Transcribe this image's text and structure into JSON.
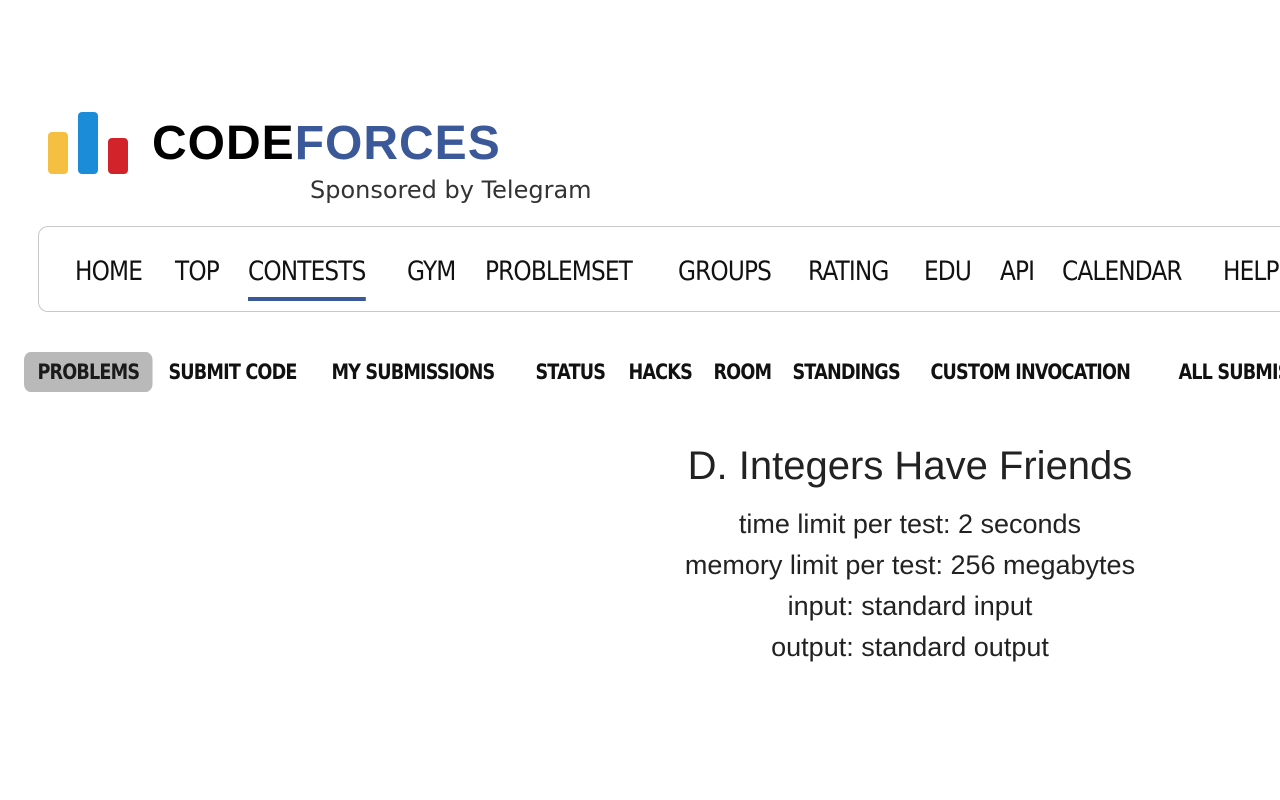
{
  "brand": {
    "name_part1": "CODE",
    "name_part2": "FORCES",
    "tagline": "Sponsored by Telegram",
    "colors": {
      "yellow": "#f5bf42",
      "blue": "#1a8cd8",
      "red": "#d2232a",
      "forces_text": "#3b5998"
    }
  },
  "main_nav": {
    "items": [
      {
        "label": "HOME"
      },
      {
        "label": "TOP"
      },
      {
        "label": "CONTESTS"
      },
      {
        "label": "GYM"
      },
      {
        "label": "PROBLEMSET"
      },
      {
        "label": "GROUPS"
      },
      {
        "label": "RATING"
      },
      {
        "label": "EDU"
      },
      {
        "label": "API"
      },
      {
        "label": "CALENDAR"
      },
      {
        "label": "HELP"
      }
    ],
    "active": "CONTESTS"
  },
  "sub_nav": {
    "items": [
      {
        "label": "PROBLEMS"
      },
      {
        "label": "SUBMIT CODE"
      },
      {
        "label": "MY SUBMISSIONS"
      },
      {
        "label": "STATUS"
      },
      {
        "label": "HACKS"
      },
      {
        "label": "ROOM"
      },
      {
        "label": "STANDINGS"
      },
      {
        "label": "CUSTOM INVOCATION"
      },
      {
        "label": "ALL SUBMISSIONS"
      }
    ],
    "selected": "PROBLEMS"
  },
  "problem": {
    "title": "D. Integers Have Friends",
    "time_limit": "time limit per test: 2 seconds",
    "memory_limit": "memory limit per test: 256 megabytes",
    "input": "input: standard input",
    "output": "output: standard output"
  }
}
